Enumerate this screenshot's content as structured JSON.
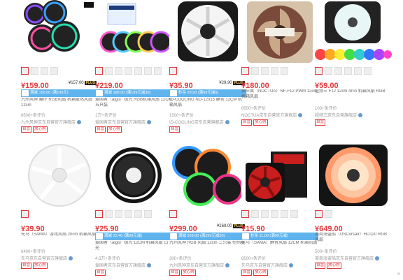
{
  "products": [
    {
      "price": "¥159.00",
      "plus": "¥157.00",
      "promo": "满减 150.00 (满199元)",
      "title": "九州风神 魔环 RGB风扇 机箱散热风扇 12cm",
      "comments": "8500+条评价",
      "shop": "九州风神京东自营官方旗舰店",
      "tags": [
        "自营",
        "放心购"
      ]
    },
    {
      "price": "¥219.00",
      "plus": "",
      "promo": "满减 189.00 (满199元减30)",
      "title": "爱国者（aigo）极光 RGB机箱风扇 12CM 五只装",
      "comments": "1万+条评价",
      "shop": "爱国者京东自营官方旗舰店",
      "tags": [
        "自营",
        "放心购"
      ]
    },
    {
      "price": "¥35.90",
      "plus": "¥29.90",
      "promo": "秒杀 29.90 (满99元减6)",
      "title": "ID-COOLING NO-12015 静音 12CM 机箱风扇",
      "comments": "1500+条评价",
      "shop": "ID-COOLING京东自营旗舰店",
      "tags": [
        "自营"
      ]
    },
    {
      "price": "¥180.00",
      "plus": "",
      "promo": "",
      "title": "猫头鹰（NOCTUA）NF-F12 PWM 12cm 机箱风扇",
      "comments": "8500+条评价",
      "shop": "NOCTUA京东自营官方旗舰店",
      "tags": [
        "自营",
        "放心购"
      ]
    },
    {
      "price": "¥59.00",
      "plus": "",
      "promo": "",
      "title": "超频三 F12 12cm 4Pin 机箱风扇 RGB",
      "comments": "100+条评价",
      "shop": "超频三京东自营旗舰店",
      "tags": [
        "自营"
      ]
    },
    {
      "price": "¥39.90",
      "plus": "",
      "promo": "",
      "title": "先马（SAMA）游戏风扇 20cm 机箱风扇",
      "comments": "6400+条评价",
      "shop": "先马京东自营官方旗舰店",
      "tags": [
        "自营",
        "放心购"
      ]
    },
    {
      "price": "¥25.90",
      "plus": "",
      "promo": "满减 22.40 (满99元减)",
      "title": "爱国者（aigo）极光 12CM 机箱风扇 白光",
      "comments": "4.6万+条评价",
      "shop": "爱国者京东自营官方旗舰店",
      "tags": [
        "自营"
      ]
    },
    {
      "price": "¥299.00",
      "plus": "¥269.00",
      "promo": "满减 269.00 (满299元减30)",
      "title": "九州风神 RGB 风扇 12cm 三只装 控制器",
      "comments": "300+条评价",
      "shop": "九州风神京东自营官方旗舰店",
      "tags": [
        "自营",
        "放心购"
      ]
    },
    {
      "price": "¥15.90",
      "plus": "",
      "promo": "秒杀 11.00 (满99元减)",
      "title": "先马（SAMA）静音风扇 12CM 机箱风扇",
      "comments": "8500+条评价",
      "shop": "先马京东自营官方旗舰店",
      "tags": [
        "自营",
        "放心购"
      ]
    },
    {
      "price": "¥649.00",
      "plus": "",
      "promo": "",
      "title": "美商海盗船（USCorsair）HD120 RGB 风扇",
      "comments": "500+条评价",
      "shop": "美商海盗船京东自营官方旗舰店",
      "tags": [
        "自营",
        "放心购"
      ]
    }
  ],
  "colors": {
    "accent": "#e4393c",
    "promo": "#5fb4ee",
    "link": "#3366bb"
  }
}
